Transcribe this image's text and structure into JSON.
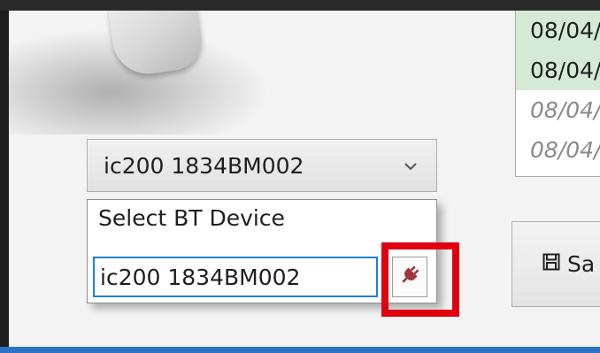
{
  "device_selector": {
    "selected": "ic200 1834BM002",
    "chevron": "chevron-down-icon"
  },
  "bt_dropdown": {
    "label": "Select BT Device",
    "device_input_value": "ic200 1834BM002",
    "connect_icon": "plug-icon"
  },
  "log": {
    "rows": [
      "08/04/",
      "08/04/",
      "08/04/",
      "08/04/"
    ]
  },
  "save": {
    "label": "Sa",
    "icon": "floppy-disk-icon"
  },
  "colors": {
    "highlight": "#e0000f",
    "input_focus": "#1e7fd8",
    "log_highlight": "#d4ead6",
    "plug": "#a1353f"
  }
}
